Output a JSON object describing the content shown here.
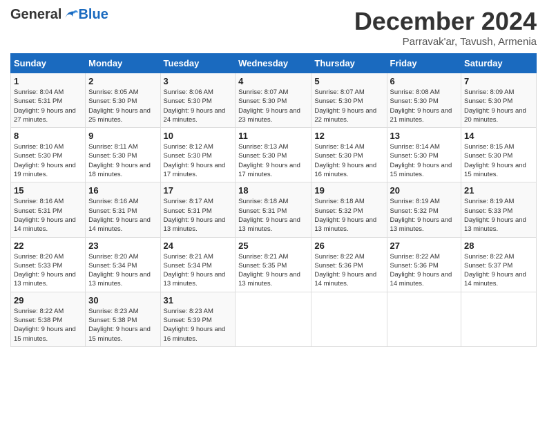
{
  "logo": {
    "general": "General",
    "blue": "Blue"
  },
  "header": {
    "month": "December 2024",
    "location": "Parravak'ar, Tavush, Armenia"
  },
  "weekdays": [
    "Sunday",
    "Monday",
    "Tuesday",
    "Wednesday",
    "Thursday",
    "Friday",
    "Saturday"
  ],
  "weeks": [
    [
      {
        "day": "1",
        "sunrise": "Sunrise: 8:04 AM",
        "sunset": "Sunset: 5:31 PM",
        "daylight": "Daylight: 9 hours and 27 minutes."
      },
      {
        "day": "2",
        "sunrise": "Sunrise: 8:05 AM",
        "sunset": "Sunset: 5:30 PM",
        "daylight": "Daylight: 9 hours and 25 minutes."
      },
      {
        "day": "3",
        "sunrise": "Sunrise: 8:06 AM",
        "sunset": "Sunset: 5:30 PM",
        "daylight": "Daylight: 9 hours and 24 minutes."
      },
      {
        "day": "4",
        "sunrise": "Sunrise: 8:07 AM",
        "sunset": "Sunset: 5:30 PM",
        "daylight": "Daylight: 9 hours and 23 minutes."
      },
      {
        "day": "5",
        "sunrise": "Sunrise: 8:07 AM",
        "sunset": "Sunset: 5:30 PM",
        "daylight": "Daylight: 9 hours and 22 minutes."
      },
      {
        "day": "6",
        "sunrise": "Sunrise: 8:08 AM",
        "sunset": "Sunset: 5:30 PM",
        "daylight": "Daylight: 9 hours and 21 minutes."
      },
      {
        "day": "7",
        "sunrise": "Sunrise: 8:09 AM",
        "sunset": "Sunset: 5:30 PM",
        "daylight": "Daylight: 9 hours and 20 minutes."
      }
    ],
    [
      {
        "day": "8",
        "sunrise": "Sunrise: 8:10 AM",
        "sunset": "Sunset: 5:30 PM",
        "daylight": "Daylight: 9 hours and 19 minutes."
      },
      {
        "day": "9",
        "sunrise": "Sunrise: 8:11 AM",
        "sunset": "Sunset: 5:30 PM",
        "daylight": "Daylight: 9 hours and 18 minutes."
      },
      {
        "day": "10",
        "sunrise": "Sunrise: 8:12 AM",
        "sunset": "Sunset: 5:30 PM",
        "daylight": "Daylight: 9 hours and 17 minutes."
      },
      {
        "day": "11",
        "sunrise": "Sunrise: 8:13 AM",
        "sunset": "Sunset: 5:30 PM",
        "daylight": "Daylight: 9 hours and 17 minutes."
      },
      {
        "day": "12",
        "sunrise": "Sunrise: 8:14 AM",
        "sunset": "Sunset: 5:30 PM",
        "daylight": "Daylight: 9 hours and 16 minutes."
      },
      {
        "day": "13",
        "sunrise": "Sunrise: 8:14 AM",
        "sunset": "Sunset: 5:30 PM",
        "daylight": "Daylight: 9 hours and 15 minutes."
      },
      {
        "day": "14",
        "sunrise": "Sunrise: 8:15 AM",
        "sunset": "Sunset: 5:30 PM",
        "daylight": "Daylight: 9 hours and 15 minutes."
      }
    ],
    [
      {
        "day": "15",
        "sunrise": "Sunrise: 8:16 AM",
        "sunset": "Sunset: 5:31 PM",
        "daylight": "Daylight: 9 hours and 14 minutes."
      },
      {
        "day": "16",
        "sunrise": "Sunrise: 8:16 AM",
        "sunset": "Sunset: 5:31 PM",
        "daylight": "Daylight: 9 hours and 14 minutes."
      },
      {
        "day": "17",
        "sunrise": "Sunrise: 8:17 AM",
        "sunset": "Sunset: 5:31 PM",
        "daylight": "Daylight: 9 hours and 13 minutes."
      },
      {
        "day": "18",
        "sunrise": "Sunrise: 8:18 AM",
        "sunset": "Sunset: 5:31 PM",
        "daylight": "Daylight: 9 hours and 13 minutes."
      },
      {
        "day": "19",
        "sunrise": "Sunrise: 8:18 AM",
        "sunset": "Sunset: 5:32 PM",
        "daylight": "Daylight: 9 hours and 13 minutes."
      },
      {
        "day": "20",
        "sunrise": "Sunrise: 8:19 AM",
        "sunset": "Sunset: 5:32 PM",
        "daylight": "Daylight: 9 hours and 13 minutes."
      },
      {
        "day": "21",
        "sunrise": "Sunrise: 8:19 AM",
        "sunset": "Sunset: 5:33 PM",
        "daylight": "Daylight: 9 hours and 13 minutes."
      }
    ],
    [
      {
        "day": "22",
        "sunrise": "Sunrise: 8:20 AM",
        "sunset": "Sunset: 5:33 PM",
        "daylight": "Daylight: 9 hours and 13 minutes."
      },
      {
        "day": "23",
        "sunrise": "Sunrise: 8:20 AM",
        "sunset": "Sunset: 5:34 PM",
        "daylight": "Daylight: 9 hours and 13 minutes."
      },
      {
        "day": "24",
        "sunrise": "Sunrise: 8:21 AM",
        "sunset": "Sunset: 5:34 PM",
        "daylight": "Daylight: 9 hours and 13 minutes."
      },
      {
        "day": "25",
        "sunrise": "Sunrise: 8:21 AM",
        "sunset": "Sunset: 5:35 PM",
        "daylight": "Daylight: 9 hours and 13 minutes."
      },
      {
        "day": "26",
        "sunrise": "Sunrise: 8:22 AM",
        "sunset": "Sunset: 5:36 PM",
        "daylight": "Daylight: 9 hours and 14 minutes."
      },
      {
        "day": "27",
        "sunrise": "Sunrise: 8:22 AM",
        "sunset": "Sunset: 5:36 PM",
        "daylight": "Daylight: 9 hours and 14 minutes."
      },
      {
        "day": "28",
        "sunrise": "Sunrise: 8:22 AM",
        "sunset": "Sunset: 5:37 PM",
        "daylight": "Daylight: 9 hours and 14 minutes."
      }
    ],
    [
      {
        "day": "29",
        "sunrise": "Sunrise: 8:22 AM",
        "sunset": "Sunset: 5:38 PM",
        "daylight": "Daylight: 9 hours and 15 minutes."
      },
      {
        "day": "30",
        "sunrise": "Sunrise: 8:23 AM",
        "sunset": "Sunset: 5:38 PM",
        "daylight": "Daylight: 9 hours and 15 minutes."
      },
      {
        "day": "31",
        "sunrise": "Sunrise: 8:23 AM",
        "sunset": "Sunset: 5:39 PM",
        "daylight": "Daylight: 9 hours and 16 minutes."
      },
      null,
      null,
      null,
      null
    ]
  ]
}
